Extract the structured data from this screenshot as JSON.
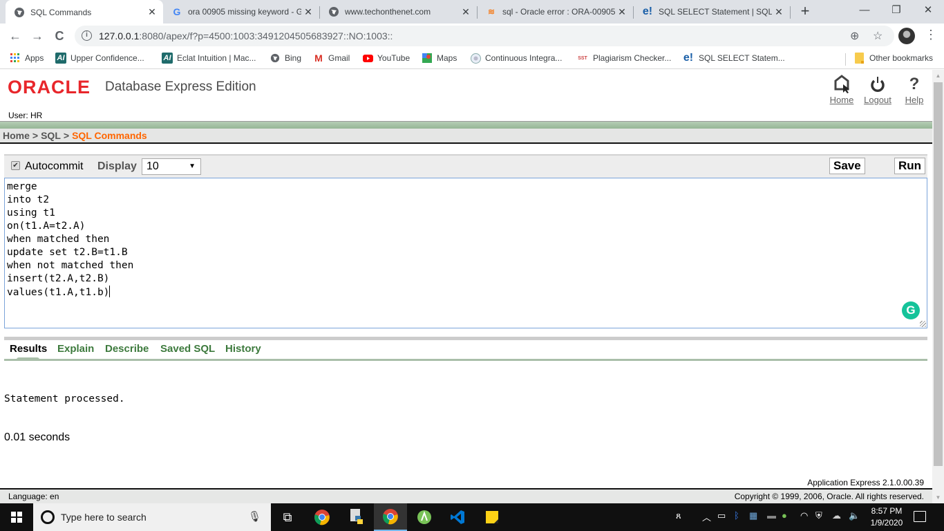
{
  "browser": {
    "tabs": [
      {
        "title": "SQL Commands",
        "icon": "globe-icon",
        "active": true
      },
      {
        "title": "ora 00905 missing keyword - G",
        "icon": "google-icon",
        "active": false
      },
      {
        "title": "www.techonthenet.com",
        "icon": "globe-icon",
        "active": false
      },
      {
        "title": "sql - Oracle error : ORA-00905:",
        "icon": "stackoverflow-icon",
        "active": false
      },
      {
        "title": "SQL SELECT Statement | SQL S",
        "icon": "e-icon",
        "active": false
      }
    ],
    "new_tab": "+",
    "window_controls": {
      "minimize": "—",
      "restore": "❐",
      "close": "✕"
    },
    "nav": {
      "back": "←",
      "forward": "→",
      "reload": "C"
    },
    "url": {
      "host": "127.0.0.1",
      "rest": ":8080/apex/f?p=4500:1003:3491204505683927::NO:1003::"
    },
    "bookmarks": [
      {
        "label": "Apps",
        "icon": "apps-grid-icon"
      },
      {
        "label": "Upper Confidence...",
        "icon": "ai-icon"
      },
      {
        "label": "Eclat Intuition | Mac...",
        "icon": "ai-icon"
      },
      {
        "label": "Bing",
        "icon": "globe-icon"
      },
      {
        "label": "Gmail",
        "icon": "gmail-icon"
      },
      {
        "label": "YouTube",
        "icon": "youtube-icon"
      },
      {
        "label": "Maps",
        "icon": "maps-icon"
      },
      {
        "label": "Continuous Integra...",
        "icon": "jenkins-icon"
      },
      {
        "label": "Plagiarism Checker...",
        "icon": "sst-icon"
      },
      {
        "label": "SQL SELECT Statem...",
        "icon": "e-icon"
      }
    ],
    "other_bookmarks": "Other bookmarks"
  },
  "app": {
    "logo": "ORACLE",
    "product": "Database Express Edition",
    "header_links": [
      {
        "label": "Home",
        "icon": "home-icon"
      },
      {
        "label": "Logout",
        "icon": "power-icon"
      },
      {
        "label": "Help",
        "icon": "help-icon"
      }
    ],
    "user": "User: HR",
    "breadcrumb": [
      {
        "label": "Home",
        "current": false
      },
      {
        "label": "SQL",
        "current": false
      },
      {
        "label": "SQL Commands",
        "current": true
      }
    ],
    "breadcrumb_sep": ">",
    "toolbar": {
      "autocommit_label": "Autocommit",
      "autocommit_checked": true,
      "display_label": "Display",
      "display_value": "10",
      "save_label": "Save",
      "run_label": "Run"
    },
    "sql_text": "merge\ninto t2\nusing t1\non(t1.A=t2.A)\nwhen matched then\nupdate set t2.B=t1.B\nwhen not matched then\ninsert(t2.A,t2.B)\nvalues(t1.A,t1.b)",
    "result_tabs": [
      "Results",
      "Explain",
      "Describe",
      "Saved SQL",
      "History"
    ],
    "active_result_tab": "Results",
    "result_message": "Statement processed.",
    "result_time": "0.01 seconds",
    "app_version": "Application Express 2.1.0.00.39",
    "language": "Language: en",
    "copyright": "Copyright © 1999, 2006, Oracle. All rights reserved."
  },
  "taskbar": {
    "search_placeholder": "Type here to search",
    "time": "8:57 PM",
    "date": "1/9/2020"
  }
}
